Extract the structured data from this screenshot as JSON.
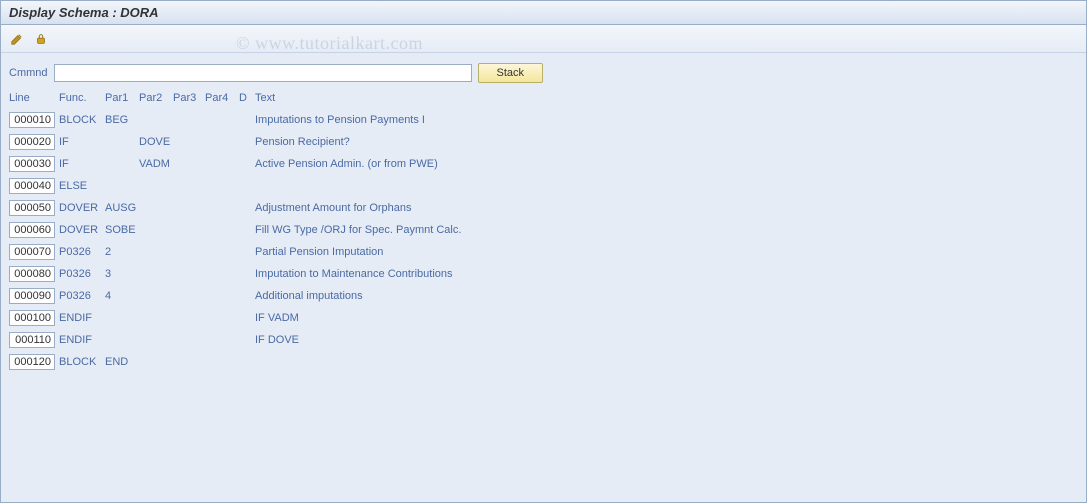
{
  "title": "Display Schema : DORA",
  "watermark": "© www.tutorialkart.com",
  "toolbar": {
    "iconA": "edit",
    "iconB": "lock"
  },
  "cmd": {
    "label": "Cmmnd",
    "value": "",
    "stack_label": "Stack"
  },
  "headers": {
    "line": "Line",
    "func": "Func.",
    "p1": "Par1",
    "p2": "Par2",
    "p3": "Par3",
    "p4": "Par4",
    "d": "D",
    "text": "Text"
  },
  "rows": [
    {
      "line": "000010",
      "func": "BLOCK",
      "p1": "BEG",
      "p2": "",
      "p3": "",
      "p4": "",
      "d": "",
      "text": "Imputations to Pension Payments I"
    },
    {
      "line": "000020",
      "func": "IF",
      "p1": "",
      "p2": "DOVE",
      "p3": "",
      "p4": "",
      "d": "",
      "text": "Pension Recipient?"
    },
    {
      "line": "000030",
      "func": "IF",
      "p1": "",
      "p2": "VADM",
      "p3": "",
      "p4": "",
      "d": "",
      "text": "Active Pension Admin. (or from PWE)"
    },
    {
      "line": "000040",
      "func": "ELSE",
      "p1": "",
      "p2": "",
      "p3": "",
      "p4": "",
      "d": "",
      "text": ""
    },
    {
      "line": "000050",
      "func": "DOVER",
      "p1": "AUSG",
      "p2": "",
      "p3": "",
      "p4": "",
      "d": "",
      "text": "Adjustment Amount for Orphans"
    },
    {
      "line": "000060",
      "func": "DOVER",
      "p1": "SOBE",
      "p2": "",
      "p3": "",
      "p4": "",
      "d": "",
      "text": "Fill WG Type /ORJ for Spec. Paymnt Calc."
    },
    {
      "line": "000070",
      "func": "P0326",
      "p1": "2",
      "p2": "",
      "p3": "",
      "p4": "",
      "d": "",
      "text": "Partial Pension Imputation"
    },
    {
      "line": "000080",
      "func": "P0326",
      "p1": "3",
      "p2": "",
      "p3": "",
      "p4": "",
      "d": "",
      "text": "Imputation to Maintenance Contributions"
    },
    {
      "line": "000090",
      "func": "P0326",
      "p1": "4",
      "p2": "",
      "p3": "",
      "p4": "",
      "d": "",
      "text": "Additional imputations"
    },
    {
      "line": "000100",
      "func": "ENDIF",
      "p1": "",
      "p2": "",
      "p3": "",
      "p4": "",
      "d": "",
      "text": "IF VADM"
    },
    {
      "line": "000110",
      "func": "ENDIF",
      "p1": "",
      "p2": "",
      "p3": "",
      "p4": "",
      "d": "",
      "text": "IF DOVE"
    },
    {
      "line": "000120",
      "func": "BLOCK",
      "p1": "END",
      "p2": "",
      "p3": "",
      "p4": "",
      "d": "",
      "text": ""
    }
  ]
}
